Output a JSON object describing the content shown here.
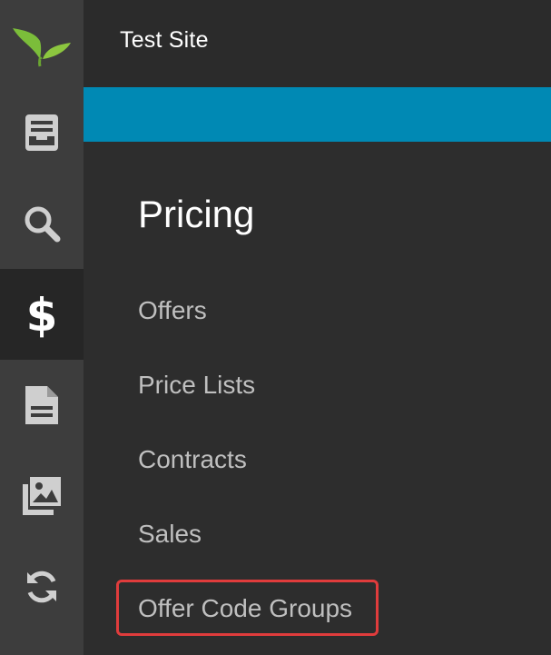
{
  "header": {
    "site_title": "Test Site"
  },
  "rail": {
    "items": [
      {
        "icon": "inbox-icon",
        "active": false
      },
      {
        "icon": "search-icon",
        "active": false
      },
      {
        "icon": "dollar-icon",
        "active": true
      },
      {
        "icon": "document-icon",
        "active": false
      },
      {
        "icon": "images-icon",
        "active": false
      },
      {
        "icon": "sync-icon",
        "active": false
      }
    ]
  },
  "panel": {
    "title": "Pricing",
    "items": [
      {
        "label": "Offers"
      },
      {
        "label": "Price Lists"
      },
      {
        "label": "Contracts"
      },
      {
        "label": "Sales"
      },
      {
        "label": "Offer Code Groups",
        "highlighted": true
      }
    ]
  },
  "colors": {
    "rail_bg": "#3d3d3d",
    "rail_active_bg": "#262626",
    "accent": "#0089b4",
    "highlight_border": "#e03c3c",
    "logo_green": "#7bbd3a"
  }
}
